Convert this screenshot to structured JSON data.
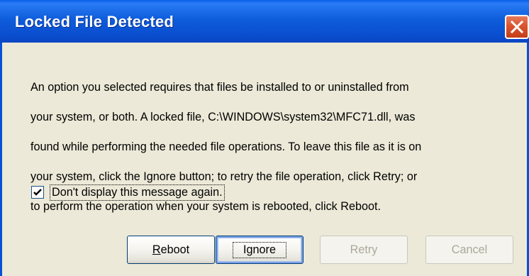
{
  "window": {
    "title": "Locked File Detected"
  },
  "icons": {
    "close": "close-icon",
    "check": "checkmark-icon"
  },
  "message": {
    "lines": [
      "An option you selected requires that files be installed to or uninstalled from",
      "your system, or both. A locked file, C:\\WINDOWS\\system32\\MFC71.dll, was",
      "found while performing the needed file operations. To leave this file as it is on",
      "your system, click the Ignore button; to retry the file operation, click Retry; or",
      "to perform the operation when your system is rebooted, click Reboot."
    ]
  },
  "checkbox": {
    "label": "Don't display this message again.",
    "checked": true
  },
  "buttons": {
    "reboot": {
      "accel": "R",
      "rest": "eboot",
      "enabled": true
    },
    "ignore": {
      "label": "Ignore",
      "enabled": true,
      "default": true
    },
    "retry": {
      "label": "Retry",
      "enabled": false
    },
    "cancel": {
      "label": "Cancel",
      "enabled": false
    }
  },
  "colors": {
    "titlebar": "#0A4FD4",
    "close_button": "#D9542E",
    "dialog_background": "#ECE9D8",
    "disabled_text": "#ACA899"
  }
}
